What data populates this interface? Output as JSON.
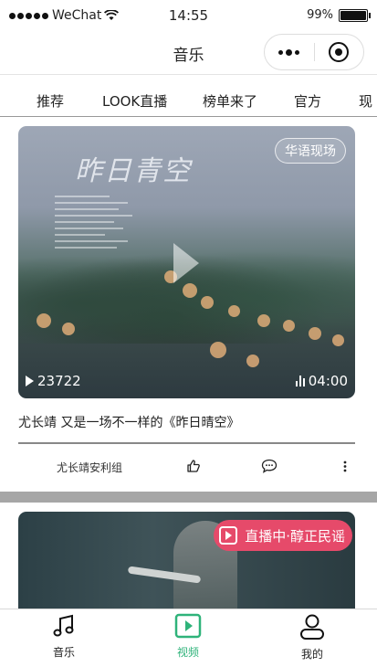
{
  "status_bar": {
    "carrier": "WeChat",
    "time": "14:55",
    "battery": "99%",
    "battery_level": 0.99
  },
  "nav": {
    "title": "音乐"
  },
  "tabs": [
    {
      "label": "推荐"
    },
    {
      "label": "LOOK直播"
    },
    {
      "label": "榜单来了"
    },
    {
      "label": "官方"
    },
    {
      "label": "现"
    }
  ],
  "video_card": {
    "tag": "华语现场",
    "album_title": "昨日青空",
    "views": "23722",
    "duration": "04:00",
    "title": "尤长靖 又是一场不一样的《昨日晴空》",
    "author": "尤长靖安利组"
  },
  "live_card": {
    "badge": "直播中·醇正民谣"
  },
  "bottom_tabs": [
    {
      "label": "音乐",
      "icon": "music-note-icon"
    },
    {
      "label": "视频",
      "icon": "video-play-icon",
      "active": true
    },
    {
      "label": "我的",
      "icon": "person-icon"
    }
  ],
  "colors": {
    "accent": "#2fb37a",
    "live_badge": "#e64a6a"
  }
}
